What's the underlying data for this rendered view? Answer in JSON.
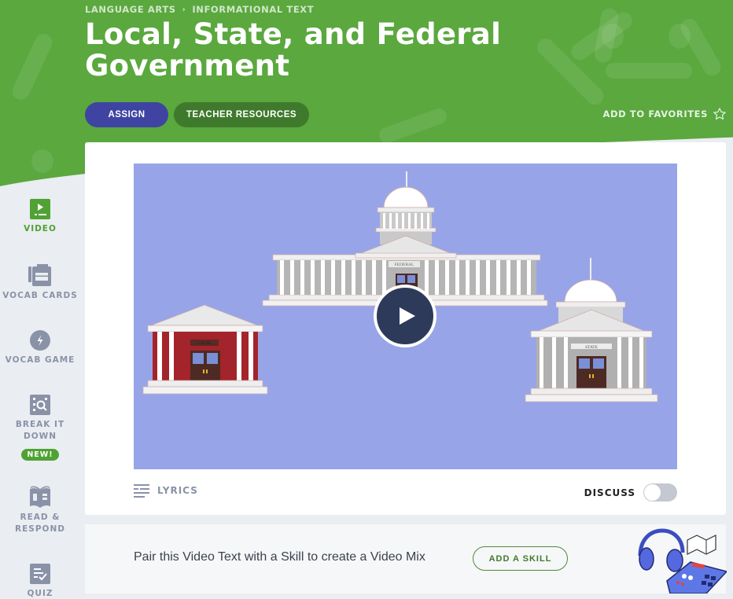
{
  "breadcrumb": {
    "items": [
      "LANGUAGE ARTS",
      "INFORMATIONAL TEXT"
    ],
    "separator": "›"
  },
  "title": "Local, State, and Federal Government",
  "actions": {
    "assign": "ASSIGN",
    "teacher_resources": "TEACHER RESOURCES",
    "favorites": "ADD TO FAVORITES"
  },
  "sidebar": {
    "items": [
      {
        "label": "VIDEO",
        "icon": "video-icon",
        "active": true
      },
      {
        "label": "VOCAB CARDS",
        "icon": "vocab-cards-icon",
        "active": false
      },
      {
        "label": "VOCAB GAME",
        "icon": "lightning-icon",
        "active": false
      },
      {
        "label": "BREAK IT DOWN",
        "icon": "magnify-icon",
        "active": false,
        "badge": "NEW!"
      },
      {
        "label": "READ & RESPOND",
        "icon": "book-icon",
        "active": false
      },
      {
        "label": "QUIZ",
        "icon": "quiz-icon",
        "active": false
      }
    ]
  },
  "video": {
    "buildings": {
      "local": "LOCAL",
      "state": "STATE",
      "federal": "FEDERAL"
    },
    "lyrics_label": "LYRICS",
    "discuss_label": "DISCUSS",
    "discuss_on": false
  },
  "mix": {
    "text": "Pair this Video Text with a Skill to create a Video Mix",
    "button": "ADD A SKILL"
  },
  "colors": {
    "brand_green": "#5aa83e",
    "assign_blue": "#3f44a3",
    "active_green": "#4fa233",
    "video_bg": "#97a5e8"
  }
}
